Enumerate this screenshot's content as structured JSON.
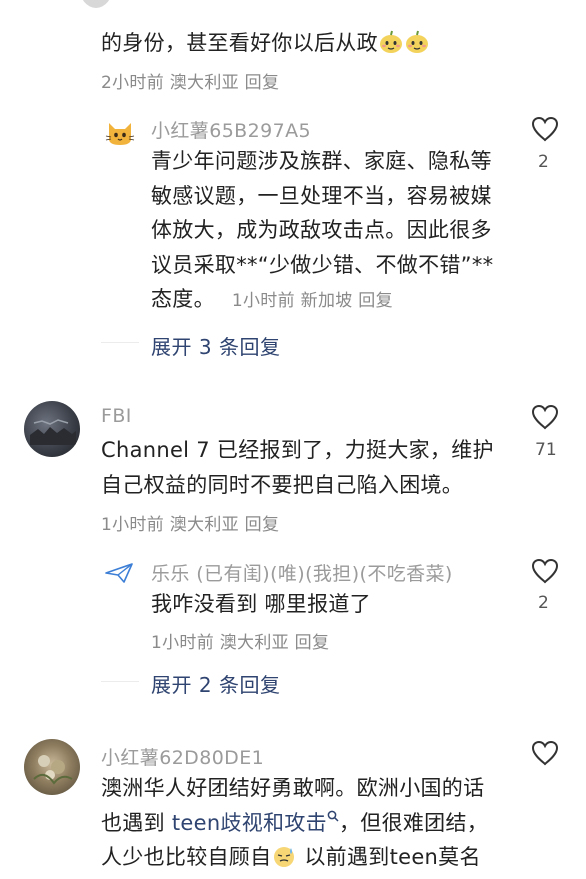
{
  "top": {
    "text": "的身份，甚至看好你以后从政",
    "meta_time": "2小时前",
    "meta_loc": "澳大利亚",
    "meta_reply": "回复"
  },
  "reply1": {
    "username": "小红薯65B297A5",
    "lines": [
      "青少年问题涉及族群、家庭、隐私等",
      "敏感议题，一旦处理不当，容易被媒",
      "体放大，成为政敌攻击点。因此很多",
      "议员采取**“少做少错、不做不错”**",
      "态度。"
    ],
    "meta_time": "1小时前",
    "meta_loc": "新加坡",
    "meta_reply": "回复",
    "likes": "2",
    "expand": "展开 3 条回复"
  },
  "comment2": {
    "username": "FBI",
    "lines": [
      "Channel 7 已经报到了，力挺大家，维护",
      "自己权益的同时不要把自己陷入困境。"
    ],
    "meta_time": "1小时前",
    "meta_loc": "澳大利亚",
    "meta_reply": "回复",
    "likes": "71"
  },
  "reply2": {
    "username": "乐乐 (已有闺)(唯)(我担)(不吃香菜)",
    "text": "我咋没看到 哪里报道了",
    "meta_time": "1小时前",
    "meta_loc": "澳大利亚",
    "meta_reply": "回复",
    "likes": "2",
    "expand": "展开 2 条回复"
  },
  "comment3": {
    "username": "小红薯62D80DE1",
    "line1": "澳洲华人好团结好勇敢啊。欧洲小国的话",
    "line2_a": "也遇到 ",
    "line2_link": "teen歧视和攻击",
    "line2_b": "，但很难团结，",
    "line3_a": "人少也比较自顾自",
    "line3_b": " 以前遇到teen莫名"
  },
  "icons": {
    "heart": "heart-icon",
    "search": "search-icon",
    "cat": "cat-avatar",
    "plane": "paper-plane-avatar"
  },
  "colors": {
    "link": "#2f4470",
    "meta": "#8a8a8a",
    "text": "#222222"
  }
}
